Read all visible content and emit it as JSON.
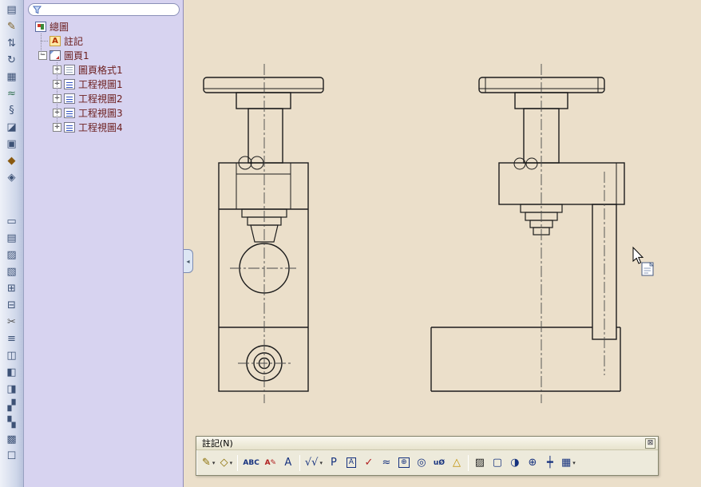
{
  "colors": {
    "canvas_bg": "#ebdfca",
    "tree_bg": "#d7d3f0",
    "float_toolbar_bg": "#edeadb",
    "tree_text": "#6b1d1d",
    "drawing_line": "#1c1c1c",
    "centerline": "#4a4a4a"
  },
  "feature_tree": {
    "filter": {
      "placeholder": "",
      "value": "",
      "icon": "filter-funnel-icon"
    },
    "splitter_glyph": "◂",
    "items": [
      {
        "label": "總圖",
        "level": 0,
        "icon": "drawing-root-icon",
        "expander": ""
      },
      {
        "label": "註記",
        "level": 1,
        "icon": "annotations-folder-icon",
        "expander": ""
      },
      {
        "label": "圖頁1",
        "level": 1,
        "icon": "sheet-icon",
        "expander": "minus"
      },
      {
        "label": "圖頁格式1",
        "level": 2,
        "icon": "sheet-format-icon",
        "expander": "plus"
      },
      {
        "label": "工程視圖1",
        "level": 2,
        "icon": "drawing-view-icon",
        "expander": "plus"
      },
      {
        "label": "工程視圖2",
        "level": 2,
        "icon": "drawing-view-icon",
        "expander": "plus"
      },
      {
        "label": "工程視圖3",
        "level": 2,
        "icon": "drawing-view-icon",
        "expander": "plus"
      },
      {
        "label": "工程視圖4",
        "level": 2,
        "icon": "drawing-view-icon",
        "expander": "plus"
      }
    ]
  },
  "left_toolbar": {
    "top_icons": [
      {
        "name": "sheet-properties-icon",
        "glyph": "▤"
      },
      {
        "name": "edit-annotation-icon",
        "glyph": "✎",
        "color": "#7a5c20"
      },
      {
        "name": "swap-arrows-icon",
        "glyph": "⇅"
      },
      {
        "name": "rotate-view-icon",
        "glyph": "↻"
      },
      {
        "name": "view-grid-icon",
        "glyph": "▦"
      },
      {
        "name": "spline-icon",
        "glyph": "≈",
        "color": "#2e6e4e"
      },
      {
        "name": "section-symbol-icon",
        "glyph": "§"
      },
      {
        "name": "projected-view-icon",
        "glyph": "◪"
      },
      {
        "name": "view-palette-icon",
        "glyph": "▣"
      },
      {
        "name": "diamond-marker-icon",
        "glyph": "◆",
        "color": "#8a5a10"
      },
      {
        "name": "small-diamond-icon",
        "glyph": "◈"
      }
    ],
    "bottom_icons": [
      {
        "name": "frame-tool-icon",
        "glyph": "▭"
      },
      {
        "name": "grid-tool-icon",
        "glyph": "▤"
      },
      {
        "name": "hatch-tool-icon",
        "glyph": "▨"
      },
      {
        "name": "pattern-tool-icon",
        "glyph": "▧"
      },
      {
        "name": "cells-tool-icon",
        "glyph": "⊞"
      },
      {
        "name": "merge-cells-icon",
        "glyph": "⊟"
      },
      {
        "name": "cut-tool-icon",
        "glyph": "✂",
        "color": "#555555"
      },
      {
        "name": "list-tool-icon",
        "glyph": "≡"
      },
      {
        "name": "columns-tool-icon",
        "glyph": "◫"
      },
      {
        "name": "half-fill-left-icon",
        "glyph": "◧"
      },
      {
        "name": "half-fill-right-icon",
        "glyph": "◨"
      },
      {
        "name": "diagonal-fill-icon",
        "glyph": "▞"
      },
      {
        "name": "diagonal-fill-alt-icon",
        "glyph": "▚"
      },
      {
        "name": "dense-fill-icon",
        "glyph": "▩"
      },
      {
        "name": "outline-box-icon",
        "glyph": "☐"
      }
    ]
  },
  "annotation_toolbar": {
    "title": "註記(N)",
    "close_glyph": "⊠",
    "icons": [
      {
        "name": "note-icon",
        "glyph": "✎",
        "color": "#8a6d00",
        "dropdown": true
      },
      {
        "name": "balloon-icon",
        "glyph": "◇",
        "color": "#8a6d00",
        "dropdown": true
      },
      {
        "separator": true
      },
      {
        "name": "spell-checker-icon",
        "glyph": "ABC",
        "color": "#15317e",
        "small": true
      },
      {
        "name": "format-painter-icon",
        "glyph": "A✎",
        "color": "#b02020",
        "small": true
      },
      {
        "name": "note-text-icon",
        "glyph": "A",
        "color": "#15317e"
      },
      {
        "separator": true
      },
      {
        "name": "surface-finish-icon",
        "glyph": "√√",
        "color": "#15317e",
        "dropdown": true
      },
      {
        "name": "weld-symbol-icon",
        "glyph": "P",
        "color": "#15317e"
      },
      {
        "name": "datum-feature-icon",
        "glyph": "A",
        "color": "#15317e",
        "boxed": true
      },
      {
        "name": "check-symbol-icon",
        "glyph": "✓",
        "color": "#b02020"
      },
      {
        "name": "caterpillar-icon",
        "glyph": "≈",
        "color": "#15317e"
      },
      {
        "name": "geometric-tolerance-icon",
        "glyph": "⊕",
        "color": "#15317e",
        "boxed": true
      },
      {
        "name": "datum-target-icon",
        "glyph": "◎",
        "color": "#15317e"
      },
      {
        "name": "hole-callout-icon",
        "glyph": "uØ",
        "color": "#15317e",
        "small": true
      },
      {
        "name": "revision-symbol-icon",
        "glyph": "△",
        "color": "#c09000"
      },
      {
        "separator": true
      },
      {
        "name": "area-hatch-icon",
        "glyph": "▨",
        "color": "#222222"
      },
      {
        "name": "revision-cloud-icon",
        "glyph": "▢",
        "color": "#15317e"
      },
      {
        "name": "dowel-pin-icon",
        "glyph": "◑",
        "color": "#15317e"
      },
      {
        "name": "center-mark-icon",
        "glyph": "⊕",
        "color": "#15317e"
      },
      {
        "name": "centerline-icon",
        "glyph": "┿",
        "color": "#15317e"
      },
      {
        "name": "table-icon",
        "glyph": "▦",
        "color": "#15317e",
        "dropdown": true
      }
    ]
  }
}
